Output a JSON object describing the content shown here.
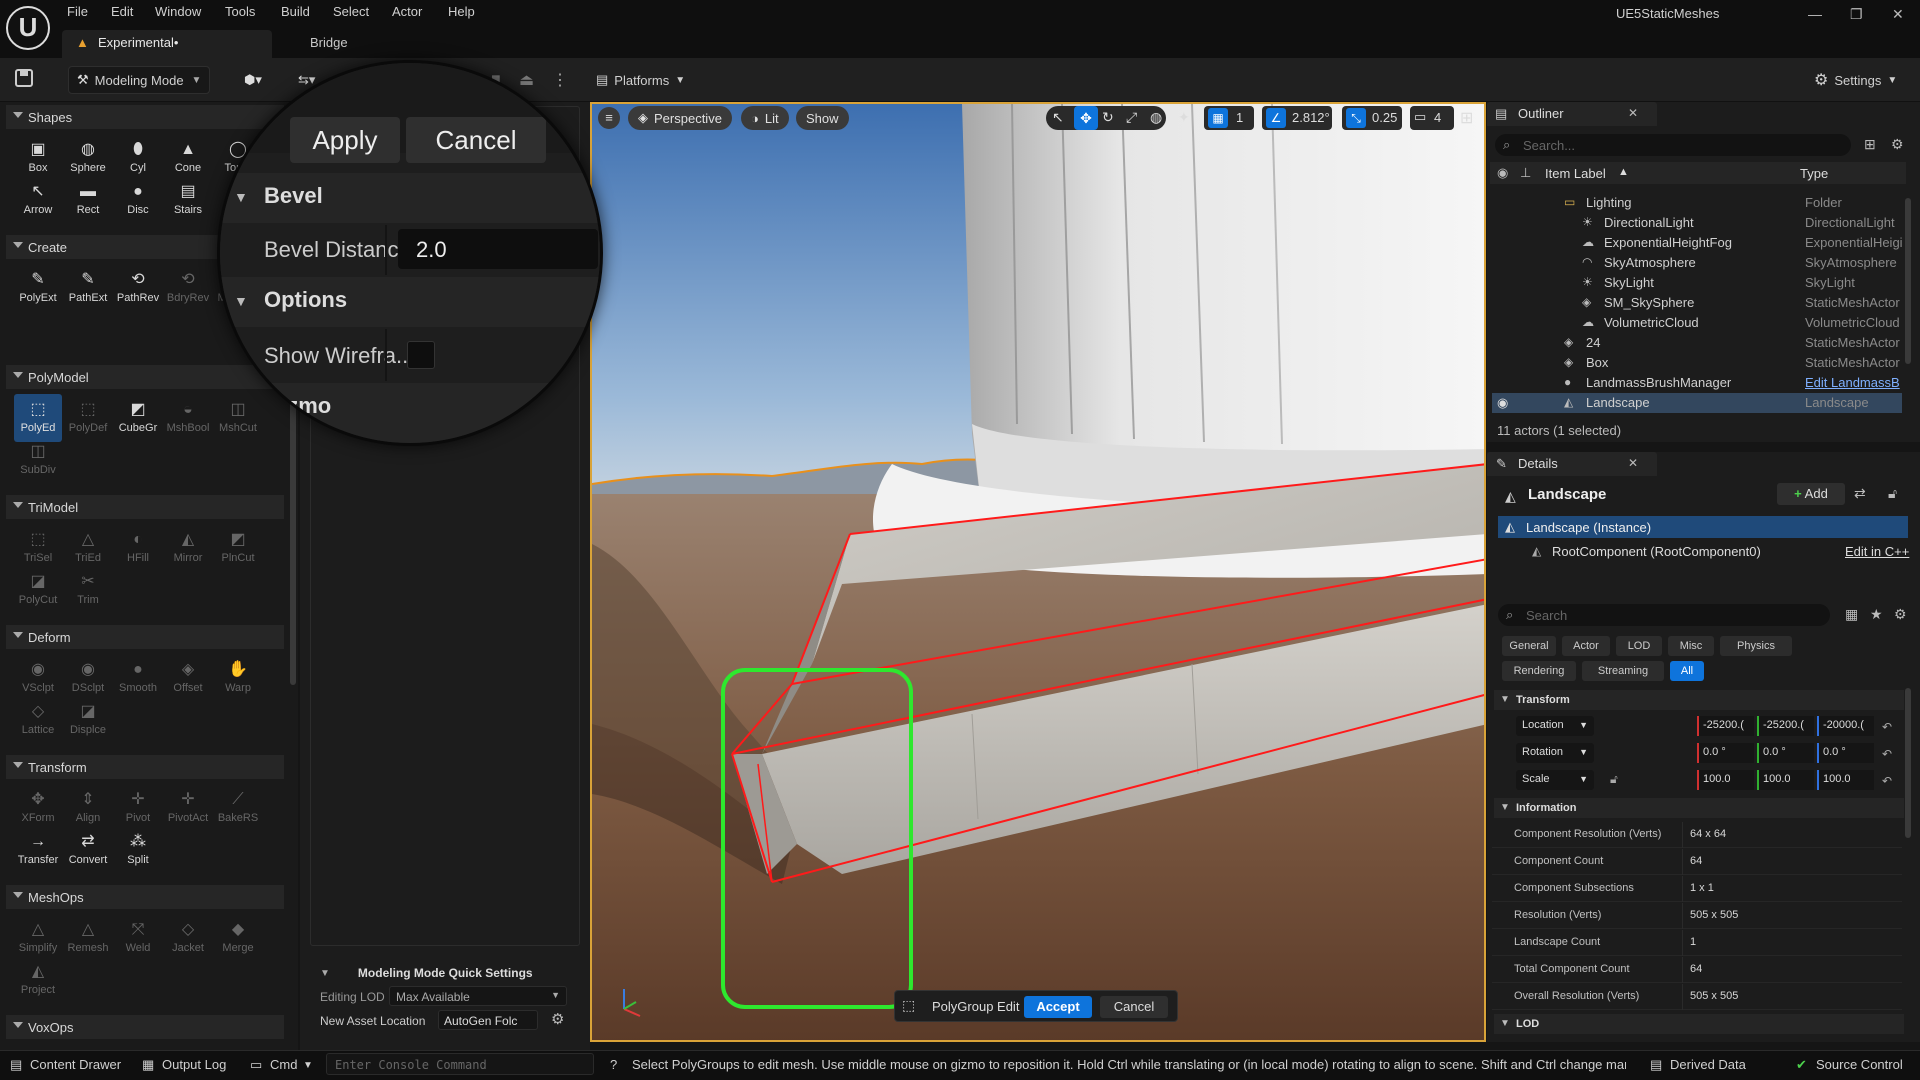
{
  "menu": [
    "File",
    "Edit",
    "Window",
    "Tools",
    "Build",
    "Select",
    "Actor",
    "Help"
  ],
  "project_name": "UE5StaticMeshes",
  "tabs": {
    "level": "Experimental•",
    "bridge": "Bridge"
  },
  "toolbar": {
    "mode": "Modeling Mode",
    "platforms": "Platforms",
    "settings": "Settings"
  },
  "shapes": {
    "title": "Shapes",
    "tools": [
      "Box",
      "Sphere",
      "Cyl",
      "Cone",
      "Torus",
      "Arrow",
      "Rect",
      "Disc",
      "Stairs"
    ]
  },
  "create": {
    "title": "Create",
    "tools": [
      "PolyExt",
      "PathExt",
      "PathRev",
      "BdryRev",
      "MshDup"
    ]
  },
  "polymodel": {
    "title": "PolyModel",
    "tools": [
      "PolyEd",
      "PolyDef",
      "CubeGr",
      "MshBool",
      "MshCut",
      "SubDiv"
    ]
  },
  "trimodel": {
    "title": "TriModel",
    "tools": [
      "TriSel",
      "TriEd",
      "HFill",
      "Mirror",
      "PlnCut",
      "PolyCut",
      "Trim"
    ]
  },
  "deform": {
    "title": "Deform",
    "tools": [
      "VSclpt",
      "DSclpt",
      "Smooth",
      "Offset",
      "Warp",
      "Lattice",
      "Displce"
    ]
  },
  "transform_tools": {
    "title": "Transform",
    "tools": [
      "XForm",
      "Align",
      "Pivot",
      "PivotAct",
      "BakeRS",
      "Transfer",
      "Convert",
      "Split"
    ]
  },
  "meshops": {
    "title": "MeshOps",
    "tools": [
      "Simplify",
      "Remesh",
      "Weld",
      "Jacket",
      "Merge",
      "Project"
    ]
  },
  "voxops": {
    "title": "VoxOps"
  },
  "magnifier": {
    "apply": "Apply",
    "cancel": "Cancel",
    "bevel_header": "Bevel",
    "bevel_distance_label": "Bevel Distance",
    "bevel_distance_value": "2.0",
    "options_header": "Options",
    "show_wireframe_label": "Show Wirefra...",
    "gizmo_header": "Gizmo"
  },
  "quick_settings": {
    "title": "Modeling Mode Quick Settings",
    "editing_lod_label": "Editing LOD",
    "editing_lod_value": "Max Available",
    "new_asset_label": "New Asset Location",
    "new_asset_value": "AutoGen Folc"
  },
  "viewport": {
    "perspective": "Perspective",
    "lit": "Lit",
    "show": "Show",
    "grid_size": "1",
    "angle": "2.812°",
    "scale": "0.25",
    "camera_speed": "4",
    "tool_name": "PolyGroup Edit",
    "accept": "Accept",
    "cancel": "Cancel"
  },
  "outliner": {
    "title": "Outliner",
    "search_placeholder": "Search...",
    "col_label": "Item Label",
    "col_type": "Type",
    "items": [
      {
        "label": "Lighting",
        "type": "Folder"
      },
      {
        "label": "DirectionalLight",
        "type": "DirectionalLight"
      },
      {
        "label": "ExponentialHeightFog",
        "type": "ExponentialHeigi"
      },
      {
        "label": "SkyAtmosphere",
        "type": "SkyAtmosphere"
      },
      {
        "label": "SkyLight",
        "type": "SkyLight"
      },
      {
        "label": "SM_SkySphere",
        "type": "StaticMeshActor"
      },
      {
        "label": "VolumetricCloud",
        "type": "VolumetricCloud"
      },
      {
        "label": "24",
        "type": "StaticMeshActor"
      },
      {
        "label": "Box",
        "type": "StaticMeshActor"
      },
      {
        "label": "LandmassBrushManager",
        "type": "Edit LandmassB"
      },
      {
        "label": "Landscape",
        "type": "Landscape"
      }
    ],
    "status": "11 actors (1 selected)"
  },
  "details": {
    "title": "Details",
    "actor_name": "Landscape",
    "add": "Add",
    "instance": "Landscape (Instance)",
    "root_component": "RootComponent (RootComponent0)",
    "edit_cpp": "Edit in C++",
    "search_placeholder": "Search",
    "filters": [
      "General",
      "Actor",
      "LOD",
      "Misc",
      "Physics",
      "Rendering",
      "Streaming",
      "All"
    ],
    "transform_header": "Transform",
    "location_label": "Location",
    "location": [
      "-25200.(",
      "-25200.(",
      "-20000.("
    ],
    "rotation_label": "Rotation",
    "rotation": [
      "0.0 °",
      "0.0 °",
      "0.0 °"
    ],
    "scale_label": "Scale",
    "scale": [
      "100.0",
      "100.0",
      "100.0"
    ],
    "information_header": "Information",
    "info": [
      {
        "label": "Component Resolution (Verts)",
        "value": "64 x 64"
      },
      {
        "label": "Component Count",
        "value": "64"
      },
      {
        "label": "Component Subsections",
        "value": "1 x 1"
      },
      {
        "label": "Resolution (Verts)",
        "value": "505 x 505"
      },
      {
        "label": "Landscape Count",
        "value": "1"
      },
      {
        "label": "Total Component Count",
        "value": "64"
      },
      {
        "label": "Overall Resolution (Verts)",
        "value": "505 x 505"
      }
    ],
    "lod_header": "LOD"
  },
  "statusbar": {
    "content_drawer": "Content Drawer",
    "output_log": "Output Log",
    "cmd": "Cmd",
    "console_placeholder": "Enter Console Command",
    "message": "Select PolyGroups to edit mesh. Use middle mouse on gizmo to reposition it. Hold Ctrl while translating or (in local mode) rotating to align to scene. Shift and Ctrl change marqu",
    "derived_data": "Derived Data",
    "source_control": "Source Control"
  },
  "colors": {
    "accent": "#0e74dc",
    "viewport_border": "#d9a338",
    "selection_box": "#2ee82e",
    "edge_highlight": "#ff1a1a"
  }
}
